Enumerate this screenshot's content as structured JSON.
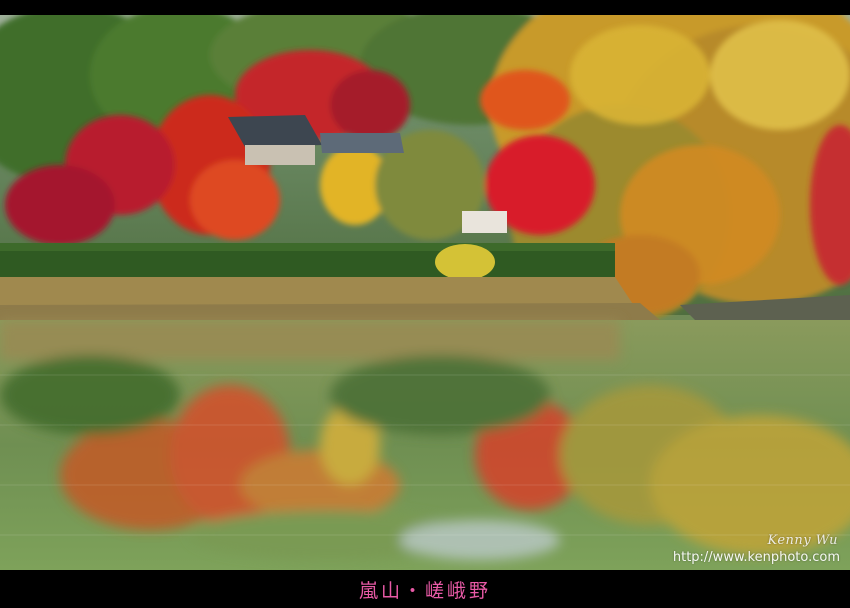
{
  "photo": {
    "signature": "Kenny Wu",
    "url": "http://www.kenphoto.com"
  },
  "caption": "嵐山・嵯峨野"
}
